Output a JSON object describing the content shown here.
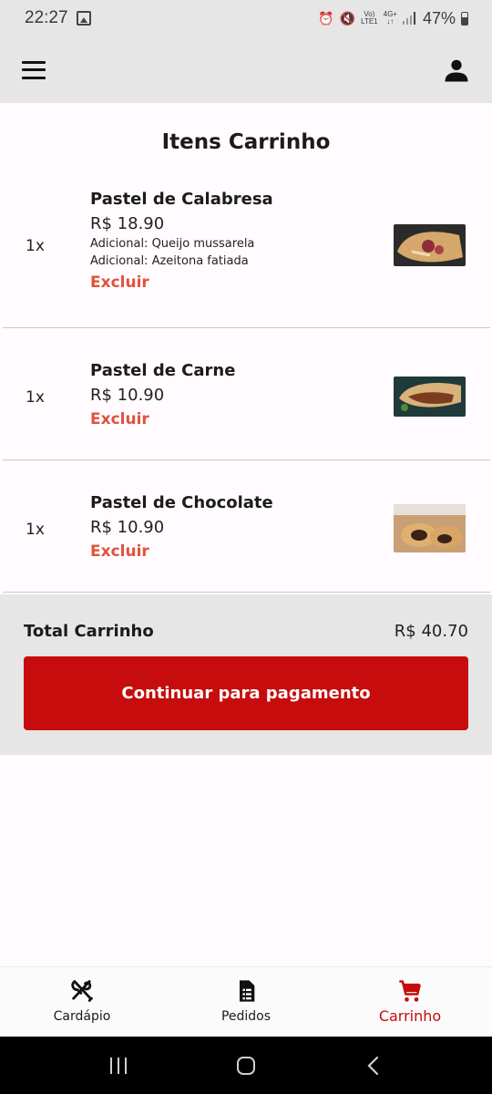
{
  "status_bar": {
    "time": "22:27",
    "network_top": "Vo)",
    "network_bottom": "LTE1",
    "gen_top": "4G+",
    "gen_bottom": "↓↑",
    "battery": "47%"
  },
  "page_title": "Itens Carrinho",
  "cart_items": [
    {
      "qty": "1x",
      "name": "Pastel de Calabresa",
      "price": "R$ 18.90",
      "addons": [
        "Adicional: Queijo mussarela",
        "Adicional: Azeitona fatiada"
      ],
      "delete_label": "Excluir"
    },
    {
      "qty": "1x",
      "name": "Pastel de Carne",
      "price": "R$ 10.90",
      "delete_label": "Excluir"
    },
    {
      "qty": "1x",
      "name": "Pastel de Chocolate",
      "price": "R$ 10.90",
      "delete_label": "Excluir"
    }
  ],
  "summary": {
    "total_label": "Total Carrinho",
    "total_value": "R$ 40.70",
    "pay_button": "Continuar para pagamento"
  },
  "bottom_nav": [
    {
      "label": "Cardápio",
      "icon": "utensils-icon"
    },
    {
      "label": "Pedidos",
      "icon": "document-icon"
    },
    {
      "label": "Carrinho",
      "icon": "cart-icon",
      "active": true
    }
  ],
  "colors": {
    "accent": "#c60c0c",
    "delete": "#e0523e",
    "bar_bg": "#e6e6e6"
  }
}
